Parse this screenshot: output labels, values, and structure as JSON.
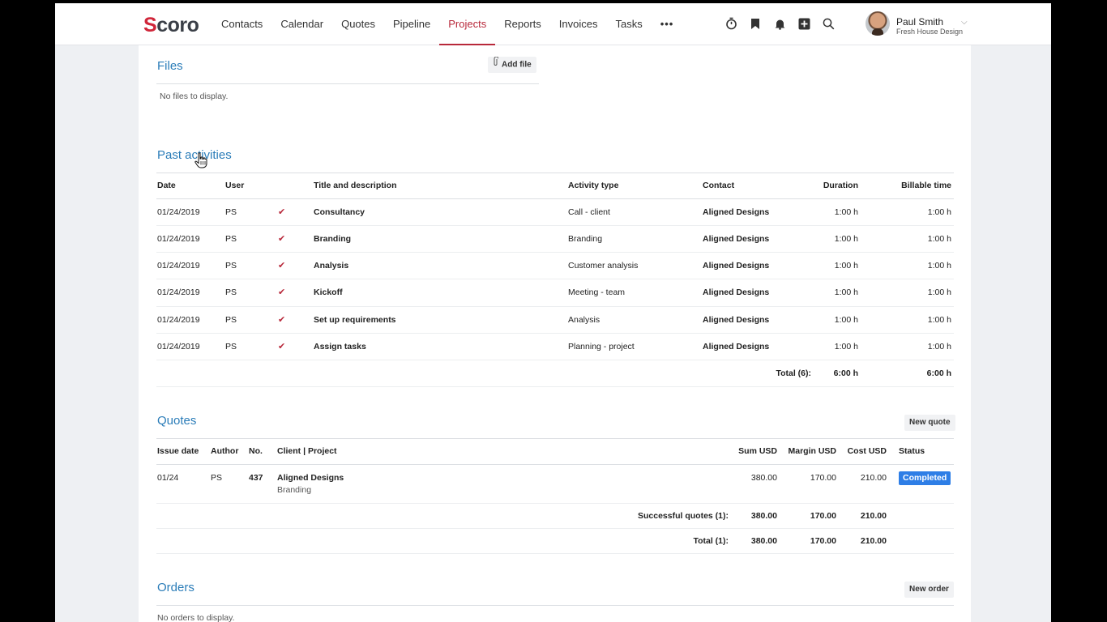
{
  "nav": {
    "logo_s": "S",
    "logo_rest": "coro",
    "items": [
      {
        "label": "Contacts"
      },
      {
        "label": "Calendar"
      },
      {
        "label": "Quotes"
      },
      {
        "label": "Pipeline"
      },
      {
        "label": "Projects",
        "active": true
      },
      {
        "label": "Reports"
      },
      {
        "label": "Invoices"
      },
      {
        "label": "Tasks"
      }
    ],
    "more": "•••",
    "icons": [
      "timer-icon",
      "bookmark-icon",
      "bell-icon",
      "add-icon",
      "search-icon"
    ]
  },
  "user": {
    "name": "Paul Smith",
    "company": "Fresh House Design",
    "chevron": "⌵"
  },
  "files": {
    "title": "Files",
    "add_label": "Add file",
    "empty": "No files to display."
  },
  "activities": {
    "title": "Past activities",
    "headers": {
      "date": "Date",
      "user": "User",
      "title": "Title and description",
      "type": "Activity type",
      "contact": "Contact",
      "duration": "Duration",
      "billable": "Billable time"
    },
    "rows": [
      {
        "date": "01/24/2019",
        "user": "PS",
        "check": "✔",
        "title": "Consultancy",
        "type": "Call - client",
        "contact": "Aligned Designs",
        "duration": "1:00 h",
        "billable": "1:00 h"
      },
      {
        "date": "01/24/2019",
        "user": "PS",
        "check": "✔",
        "title": "Branding",
        "type": "Branding",
        "contact": "Aligned Designs",
        "duration": "1:00 h",
        "billable": "1:00 h"
      },
      {
        "date": "01/24/2019",
        "user": "PS",
        "check": "✔",
        "title": "Analysis",
        "type": "Customer analysis",
        "contact": "Aligned Designs",
        "duration": "1:00 h",
        "billable": "1:00 h"
      },
      {
        "date": "01/24/2019",
        "user": "PS",
        "check": "✔",
        "title": "Kickoff",
        "type": "Meeting - team",
        "contact": "Aligned Designs",
        "duration": "1:00 h",
        "billable": "1:00 h"
      },
      {
        "date": "01/24/2019",
        "user": "PS",
        "check": "✔",
        "title": "Set up requirements",
        "type": "Analysis",
        "contact": "Aligned Designs",
        "duration": "1:00 h",
        "billable": "1:00 h"
      },
      {
        "date": "01/24/2019",
        "user": "PS",
        "check": "✔",
        "title": "Assign tasks",
        "type": "Planning - project",
        "contact": "Aligned Designs",
        "duration": "1:00 h",
        "billable": "1:00 h"
      }
    ],
    "total": {
      "label": "Total (6):",
      "duration": "6:00 h",
      "billable": "6:00 h"
    }
  },
  "quotes": {
    "title": "Quotes",
    "new_label": "New quote",
    "headers": {
      "issue": "Issue date",
      "author": "Author",
      "no": "No.",
      "client": "Client | Project",
      "sum": "Sum USD",
      "margin": "Margin USD",
      "cost": "Cost USD",
      "status": "Status"
    },
    "rows": [
      {
        "issue": "01/24",
        "author": "PS",
        "no": "437",
        "client": "Aligned Designs",
        "project": "Branding",
        "sum": "380.00",
        "margin": "170.00",
        "cost": "210.00",
        "status": "Completed"
      }
    ],
    "successful": {
      "label": "Successful quotes (1):",
      "sum": "380.00",
      "margin": "170.00",
      "cost": "210.00"
    },
    "total": {
      "label": "Total (1):",
      "sum": "380.00",
      "margin": "170.00",
      "cost": "210.00"
    }
  },
  "orders": {
    "title": "Orders",
    "new_label": "New order",
    "empty": "No orders to display."
  },
  "colors": {
    "accent": "#b8283a",
    "link": "#2a7cb8",
    "badge": "#2e7ee6"
  }
}
